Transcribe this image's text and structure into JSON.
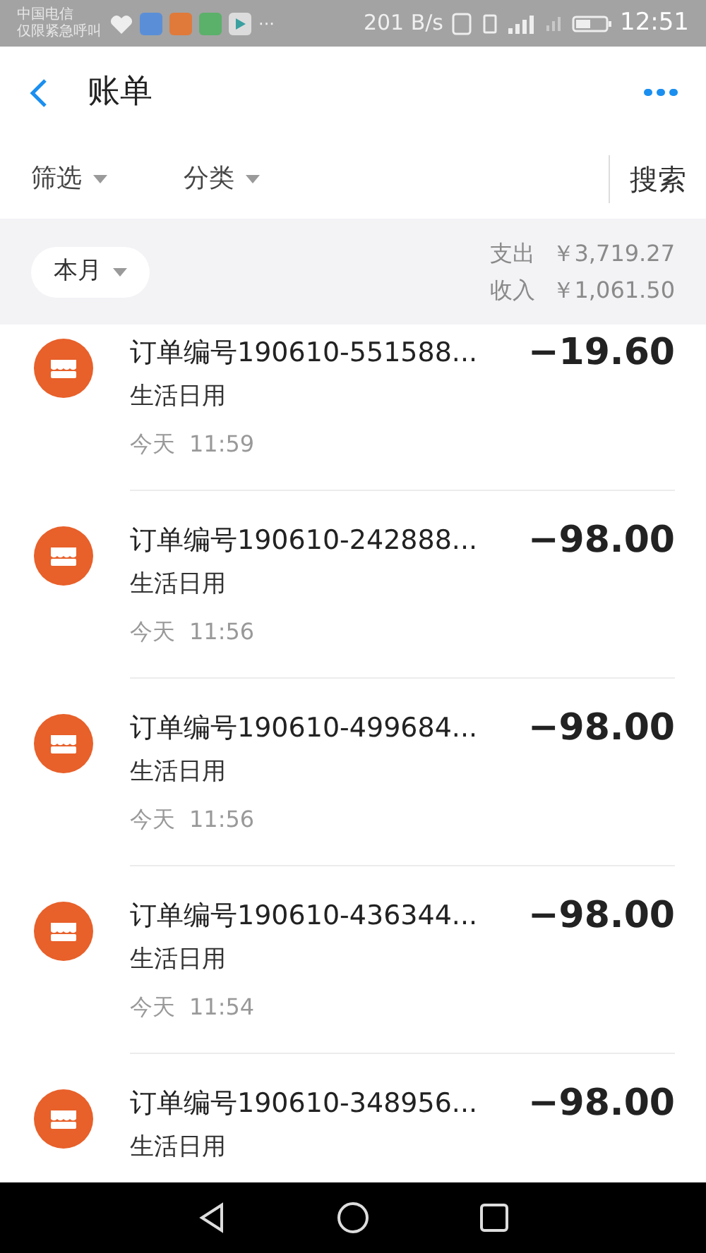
{
  "status_bar": {
    "carrier_lines": [
      "中国电信",
      "仅限紧急呼叫"
    ],
    "more": "···",
    "speed": "201 B/s",
    "time": "12:51"
  },
  "header": {
    "title": "账单"
  },
  "filter_bar": {
    "filters": [
      {
        "label": "筛选"
      },
      {
        "label": "分类"
      }
    ],
    "search": "搜索"
  },
  "summary": {
    "period": "本月",
    "rows": [
      {
        "label": "支出",
        "amount": "￥3,719.27"
      },
      {
        "label": "收入",
        "amount": "￥1,061.50"
      }
    ]
  },
  "transactions": [
    {
      "title": "订单编号190610-551588...",
      "category": "生活日用",
      "day": "今天",
      "time": "11:59",
      "amount": "−19.60"
    },
    {
      "title": "订单编号190610-242888...",
      "category": "生活日用",
      "day": "今天",
      "time": "11:56",
      "amount": "−98.00"
    },
    {
      "title": "订单编号190610-499684...",
      "category": "生活日用",
      "day": "今天",
      "time": "11:56",
      "amount": "−98.00"
    },
    {
      "title": "订单编号190610-436344...",
      "category": "生活日用",
      "day": "今天",
      "time": "11:54",
      "amount": "−98.00"
    },
    {
      "title": "订单编号190610-348956...",
      "category": "生活日用",
      "amount": "−98.00"
    }
  ]
}
